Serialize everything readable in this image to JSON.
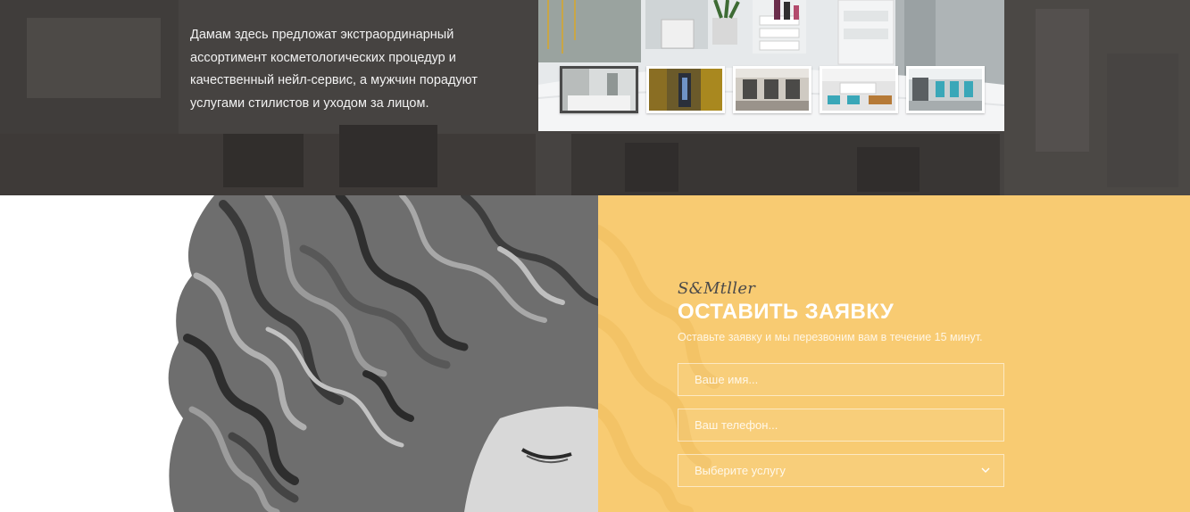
{
  "intro": {
    "lines": [
      "Дамам здесь предложат экстраординарный",
      "ассортимент косметологических процедур и",
      "качественный нейл-сервис, а мужчин порадуют",
      "услугами стилистов и уходом за лицом."
    ]
  },
  "gallery": {
    "thumbnails": [
      {
        "name": "thumb-treatment-room",
        "active": true
      },
      {
        "name": "thumb-corridor",
        "active": false
      },
      {
        "name": "thumb-hair-hall",
        "active": false
      },
      {
        "name": "thumb-reception",
        "active": false
      },
      {
        "name": "thumb-salon-hall",
        "active": false
      }
    ]
  },
  "form": {
    "brand": "S&Mtller",
    "title": "ОСТАВИТЬ ЗАЯВКУ",
    "subtitle": "Оставьте заявку и мы перезвоним вам в течение 15 минут.",
    "name_placeholder": "Ваше имя...",
    "phone_placeholder": "Ваш телефон...",
    "service_value": "Выберите услугу",
    "service_icon": "chevron-down-icon"
  },
  "colors": {
    "accent": "#f8cb72",
    "dark_overlay": "#4a4746",
    "text_light": "#ffffff",
    "brand_text": "#4b4a4a"
  }
}
